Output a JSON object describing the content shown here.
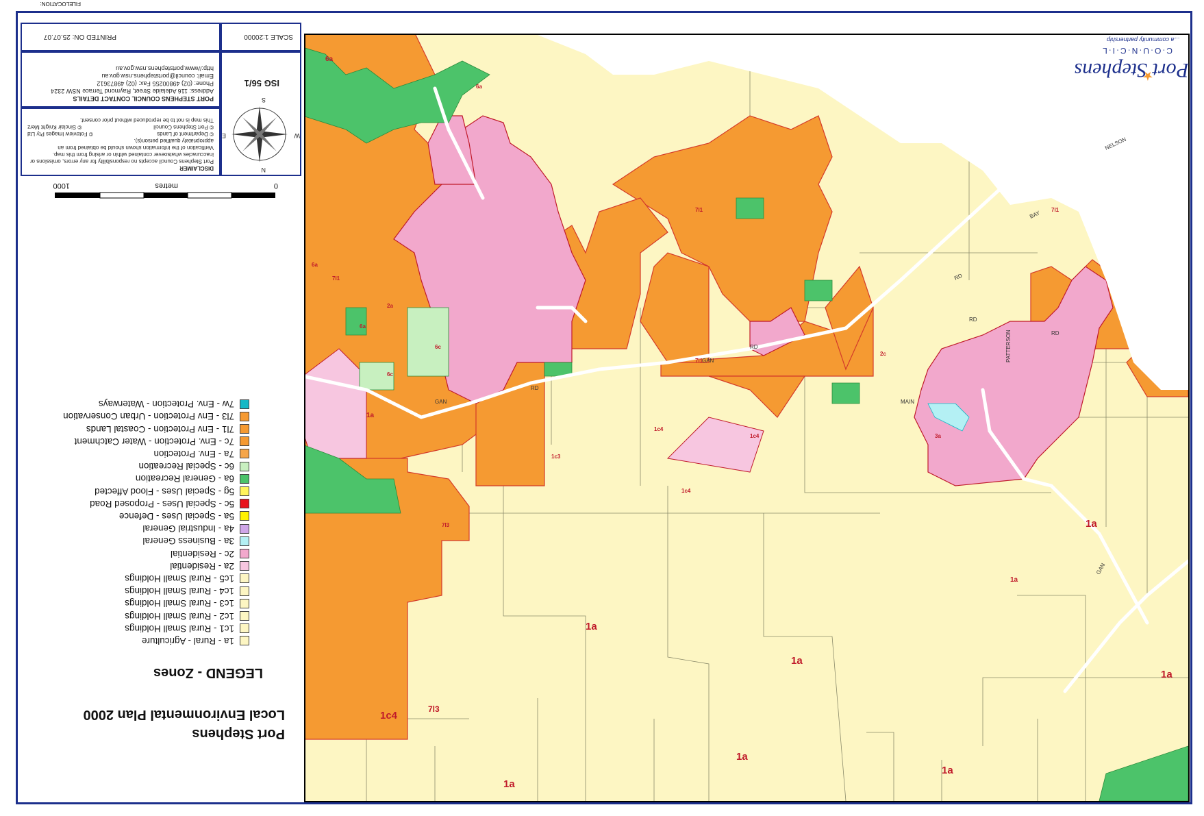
{
  "file_location_label": "FILELOCATION:",
  "plan": {
    "title_line1": "Port Stephens",
    "title_line2": "Local Environmental Plan 2000"
  },
  "legend": {
    "title": "LEGEND - Zones",
    "items": [
      {
        "code": "1a",
        "label": "1a - Rural - Agriculture",
        "color": "#fdf6c3"
      },
      {
        "code": "1c1",
        "label": "1c1 - Rural Small Holdings",
        "color": "#fdf6c3"
      },
      {
        "code": "1c2",
        "label": "1c2 - Rural Small Holdings",
        "color": "#fdf6c3"
      },
      {
        "code": "1c3",
        "label": "1c3 - Rural Small Holdings",
        "color": "#fdf6c3"
      },
      {
        "code": "1c4",
        "label": "1c4 - Rural Small Holdings",
        "color": "#fdf6c3"
      },
      {
        "code": "1c5",
        "label": "1c5 - Rural Small Holdings",
        "color": "#fdf6c3"
      },
      {
        "code": "2a",
        "label": "2a - Residential",
        "color": "#f7c6e0"
      },
      {
        "code": "2c",
        "label": "2c - Residential",
        "color": "#f2a8cc"
      },
      {
        "code": "3a",
        "label": "3a - Business General",
        "color": "#b4f0f4"
      },
      {
        "code": "4a",
        "label": "4a - Industrial General",
        "color": "#cfa6e8"
      },
      {
        "code": "5a",
        "label": "5a - Special Uses - Defence",
        "color": "#fff200"
      },
      {
        "code": "5c",
        "label": "5c - Special Uses - Proposed Road",
        "color": "#e8141c"
      },
      {
        "code": "5g",
        "label": "5g - Special Uses - Flood Affected",
        "color": "#fff45c"
      },
      {
        "code": "6a",
        "label": "6a - General Recreation",
        "color": "#4cc36a"
      },
      {
        "code": "6c",
        "label": "6c - Special Recreation",
        "color": "#c8f0c0"
      },
      {
        "code": "7a",
        "label": "7a - Env. Protection",
        "color": "#f6a64a"
      },
      {
        "code": "7c",
        "label": "7c - Env. Protection - Water Catchment",
        "color": "#f59a32"
      },
      {
        "code": "7l1",
        "label": "7l1 - Env Protection - Coastal Lands",
        "color": "#f59a32"
      },
      {
        "code": "7l3",
        "label": "7l3 - Env Protection - Urban Conservation",
        "color": "#f59a32"
      },
      {
        "code": "7w",
        "label": "7w - Env. Protection - Waterways",
        "color": "#13b8c6"
      }
    ]
  },
  "scale_bar": {
    "unit_label": "metres",
    "start_label": "0",
    "end_label": "1000"
  },
  "info": {
    "scale_label": "SCALE 1:20000",
    "printed_label": "PRINTED ON: 25.07.07",
    "isg_label": "ISG 56/1",
    "contact_title": "PORT STEPHENS COUNCIL CONTACT DETAILS",
    "contact_address": "Address: 116 Adelaide Street, Raymond Terrace NSW 2324",
    "contact_phone": "Phone: (02) 49800255 Fax: (02) 49873612",
    "contact_email": "Email: council@portstephens.nsw.gov.au",
    "contact_web": "http://www.portstephens.nsw.gov.au",
    "disclaimer_title": "DISCLAIMER",
    "disclaimer_text": "Port Stephens Council accepts no responsibility for any errors, omissions or inaccuracies whatsoever contained within or arising from this map. Verification of the information shown should be obtained from an appropriately qualified person(s).",
    "copyright_1": "© Department of Lands",
    "copyright_2": "© Port Stephens Council",
    "copyright_3": "© Fotoview Images Pty Ltd",
    "copyright_4": "© Sinclair Knight Merz",
    "copyright_note": "This map is not to be reproduced without prior consent."
  },
  "compass": {
    "n": "N",
    "s": "S",
    "e": "E",
    "w": "W"
  },
  "logo": {
    "name": "Port Stephens",
    "subtitle": "C·O·U·N·C·I·L",
    "tagline": "...a community partnership",
    "accent_color": "#1c2f8c",
    "star_color": "#f59a32"
  },
  "map": {
    "zone_labels": [
      "1a",
      "1a",
      "1a",
      "1a",
      "1a",
      "1a",
      "1a",
      "1a",
      "1a",
      "1c4",
      "1c4",
      "1c4",
      "1c3",
      "1c4",
      "2a",
      "2c",
      "3a",
      "6a",
      "6a",
      "6a",
      "6a",
      "6c",
      "6c",
      "7l1",
      "7l1",
      "7l1",
      "7l1",
      "7l3",
      "7l3"
    ],
    "road_labels": [
      "NELSON",
      "BAY",
      "RD",
      "GAN",
      "GAN",
      "RD",
      "RD",
      "RD",
      "PATTERSON",
      "MAIN",
      "RD",
      "GAN"
    ]
  }
}
